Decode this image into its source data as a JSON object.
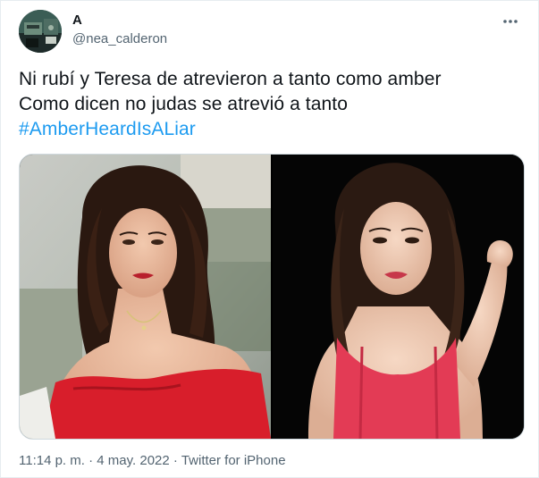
{
  "tweet": {
    "author_name": "A",
    "author_handle": "@nea_calderon",
    "text_lines": [
      "Ni rubí y Teresa de atrevieron a tanto como amber",
      "Como dicen no judas se atrevió a tanto"
    ],
    "hashtag": "#AmberHeardIsALiar",
    "time": "11:14 p. m.",
    "separator": "·",
    "date": "4 may. 2022",
    "source": "Twitter for iPhone"
  },
  "icons": {
    "more": "more-horizontal-icon"
  },
  "colors": {
    "link": "#1d9bf0",
    "secondary_text": "#536471",
    "dress_red": "#d81e2b",
    "top_pink": "#e33b55"
  }
}
